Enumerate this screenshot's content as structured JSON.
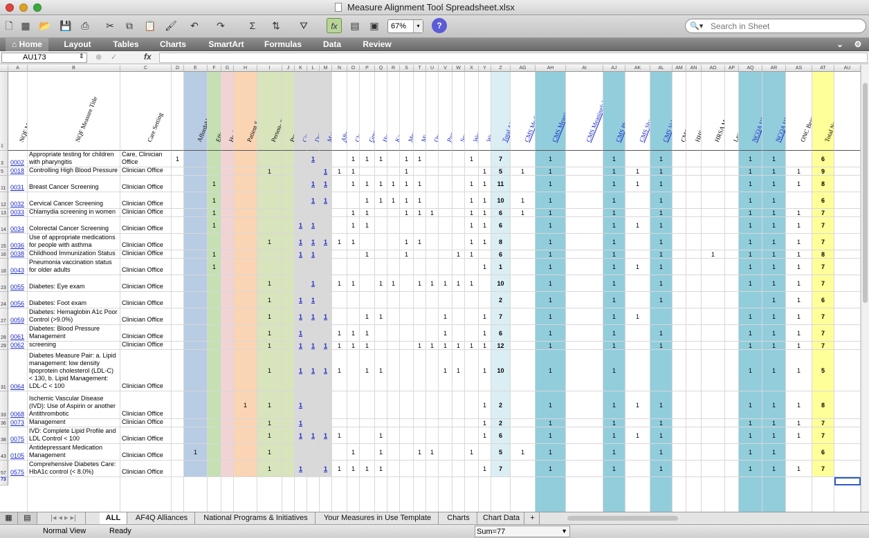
{
  "window": {
    "title": "Measure Alignment Tool Spreadsheet.xlsx"
  },
  "toolbar": {
    "zoom": "67%",
    "search_placeholder": "Search in Sheet"
  },
  "ribbon": {
    "tabs": [
      "Home",
      "Tables",
      "Layout",
      "Charts",
      "SmartArt",
      "Formulas",
      "Data",
      "Review"
    ]
  },
  "formula": {
    "cell_ref": "AU173",
    "fx": "fx"
  },
  "header": {
    "a": "NQF Measure #",
    "b": "NQF Measure Title",
    "c": "Care Setting",
    "e": "Affordable Care",
    "f": "Effective Communication and Care Coordination",
    "g": "Health and Well-Being",
    "h": "Patient Safety",
    "i": "Person- and Family-Centered Care",
    "j": "Prevention and Treatment of Leading Causes of Mortality",
    "k": "Cincinnati AF4Q",
    "l": "Detroit AF4Q",
    "m": "Maine AF4Q",
    "n": "Albuquerque AF4Q",
    "o": "Cleveland AF4Q",
    "p": "Greater Boston, MA AF4Q",
    "q": "Humboldt County, CA AF4Q",
    "r": "Kansas City, MO AF4Q",
    "s": "Memphis, TN AF4Q",
    "t": "Minnesota AF4Q",
    "u": "Oregon AF4Q",
    "v": "Puget Sound, WA AF4Q",
    "w": "South Central PA AF4Q",
    "x": "West Michigan AF4Q",
    "y": "Western New York AF4Q",
    "z": "Wisconsin AF4Q",
    "z2": "Total AF4Qs Using Measure",
    "ag": "CMS Medicaid Adult Quality Report (Adult Core)",
    "ah": "CMS Meaningful Use - Medicare and Medicaid EHR for Eligible Professionals",
    "ai": "CMS Meaningful Use - Medicare and Medicaid EHR for Hospitals and CAHs",
    "aj": "CMS Physician Quality Reporting System (PQRS)",
    "ak": "CMS Shared Savings Program (ACOs)",
    "al": "CMS Value-Based Payment Modifier",
    "am": "CMS Value-Based Purchasing",
    "an": "HHS Hospital Compare",
    "ao": "HRSA Maternal and Child Health Bureau",
    "ap": "Leapfrog Hospital Measures",
    "aq": "NCQA HEDIS Health Plan Measures",
    "ar": "NCQA HEDIS Physician Measures",
    "as": "ONC Beacon (In use by at least 1 Beacon Community)",
    "at": "Total National Initiatives Using Measure"
  },
  "col_letters": [
    "A",
    "B",
    "C",
    "D",
    "E",
    "F",
    "G",
    "H",
    "I",
    "J",
    "K",
    "L",
    "M",
    "N",
    "O",
    "P",
    "Q",
    "R",
    "S",
    "T",
    "U",
    "V",
    "W",
    "X",
    "Y",
    "Z",
    "AG",
    "AH",
    "AI",
    "AJ",
    "AK",
    "AL",
    "AM",
    "AN",
    "AO",
    "AP",
    "AQ",
    "AR",
    "AS",
    "AT",
    "AU"
  ],
  "rows": [
    {
      "rn": "3",
      "code": "0002",
      "title": "Appropriate testing for children with pharyngitis",
      "setting": "Clinic/Urgent Care, Clinician Office",
      "total_af4q": "7",
      "total_nat": "6"
    },
    {
      "rn": "5",
      "code": "0018",
      "title": "Controlling High Blood Pressure",
      "setting": "Clinician Office",
      "total_af4q": "5",
      "total_nat": "9"
    },
    {
      "rn": "11",
      "code": "0031",
      "title": "Breast Cancer Screening",
      "setting": "Clinician Office",
      "total_af4q": "11",
      "total_nat": "8"
    },
    {
      "rn": "12",
      "code": "0032",
      "title": "Cervical Cancer Screening",
      "setting": "Clinician Office",
      "total_af4q": "10",
      "total_nat": "6"
    },
    {
      "rn": "13",
      "code": "0033",
      "title": "Chlamydia screening in women",
      "setting": "Clinician Office",
      "total_af4q": "6",
      "total_nat": "7"
    },
    {
      "rn": "14",
      "code": "0034",
      "title": "Colorectal Cancer Screening",
      "setting": "Clinician Office",
      "total_af4q": "6",
      "total_nat": "7"
    },
    {
      "rn": "15",
      "code": "0036",
      "title": "Use of appropriate medications for people with asthma",
      "setting": "Clinician Office",
      "total_af4q": "8",
      "total_nat": "7"
    },
    {
      "rn": "16",
      "code": "0038",
      "title": "Childhood Immunization Status",
      "setting": "Clinician Office",
      "total_af4q": "6",
      "total_nat": "8"
    },
    {
      "rn": "18",
      "code": "0043",
      "title": "Pneumonia vaccination status for older adults",
      "setting": "Clinician Office",
      "total_af4q": "1",
      "total_nat": "7"
    },
    {
      "rn": "23",
      "code": "0055",
      "title": "Diabetes: Eye exam",
      "setting": "Clinician Office",
      "total_af4q": "10",
      "total_nat": "7"
    },
    {
      "rn": "24",
      "code": "0056",
      "title": "Diabetes: Foot exam",
      "setting": "Clinician Office",
      "total_af4q": "2",
      "total_nat": "6"
    },
    {
      "rn": "27",
      "code": "0059",
      "title": "Diabetes: Hemaglobin A1c Poor Control (>9.0%)",
      "setting": "Clinician Office",
      "total_af4q": "7",
      "total_nat": "7"
    },
    {
      "rn": "28",
      "code": "0061",
      "title": "Diabetes: Blood Pressure Management",
      "setting": "Clinician Office",
      "total_af4q": "6",
      "total_nat": "7"
    },
    {
      "rn": "29",
      "code": "0062",
      "title": "Diabetes: Urine protein screening",
      "setting": "Clinician Office",
      "total_af4q": "12",
      "total_nat": "7"
    },
    {
      "rn": "31",
      "code": "0064",
      "title": "Diabetes Measure Pair: a. Lipid management: low density lipoprotein cholesterol (LDL-C) < 130, b. Lipid Management: LDL-C < 100",
      "setting": "Clinician Office",
      "total_af4q": "10",
      "total_nat": "5"
    },
    {
      "rn": "33",
      "code": "0068",
      "title": "Ischemic Vascular Disease (IVD): Use of Aspirin or another Antithrombotic",
      "setting": "Clinician Office",
      "total_af4q": "2",
      "total_nat": "8"
    },
    {
      "rn": "36",
      "code": "0073",
      "title": "IVD: Blood Pressure Management",
      "setting": "Clinician Office",
      "total_af4q": "2",
      "total_nat": "7"
    },
    {
      "rn": "38",
      "code": "0075",
      "title": "IVD: Complete Lipid Profile and LDL Control < 100",
      "setting": "Clinician Office",
      "total_af4q": "6",
      "total_nat": "7"
    },
    {
      "rn": "43",
      "code": "0105",
      "title": "Antidepressant Medication Management",
      "setting": "Clinician Office",
      "total_af4q": "5",
      "total_nat": "6"
    },
    {
      "rn": "57",
      "code": "0575",
      "title": "Comprehensive Diabetes Care: HbA1c control (< 8.0%)",
      "setting": "Clinician Office",
      "total_af4q": "7",
      "total_nat": "7"
    }
  ],
  "last_row": "73",
  "sheet_tabs": [
    "ALL",
    "AF4Q Alliances",
    "National Programs & Initiatives",
    "Your Measures in Use Template",
    "Charts",
    "Chart Data"
  ],
  "status": {
    "view": "Normal View",
    "ready": "Ready",
    "sum": "Sum=77"
  },
  "colors": {
    "green": "#c6e0b4",
    "blue_priority": "#b8cce4",
    "pink": "#f2d3d3",
    "orange": "#fbd4b4",
    "lightgreen": "#d8e4bc",
    "grey": "#d9d9d9",
    "teal": "#92cddc",
    "lightblue": "#dbeef4",
    "yellow": "#ffff99"
  }
}
